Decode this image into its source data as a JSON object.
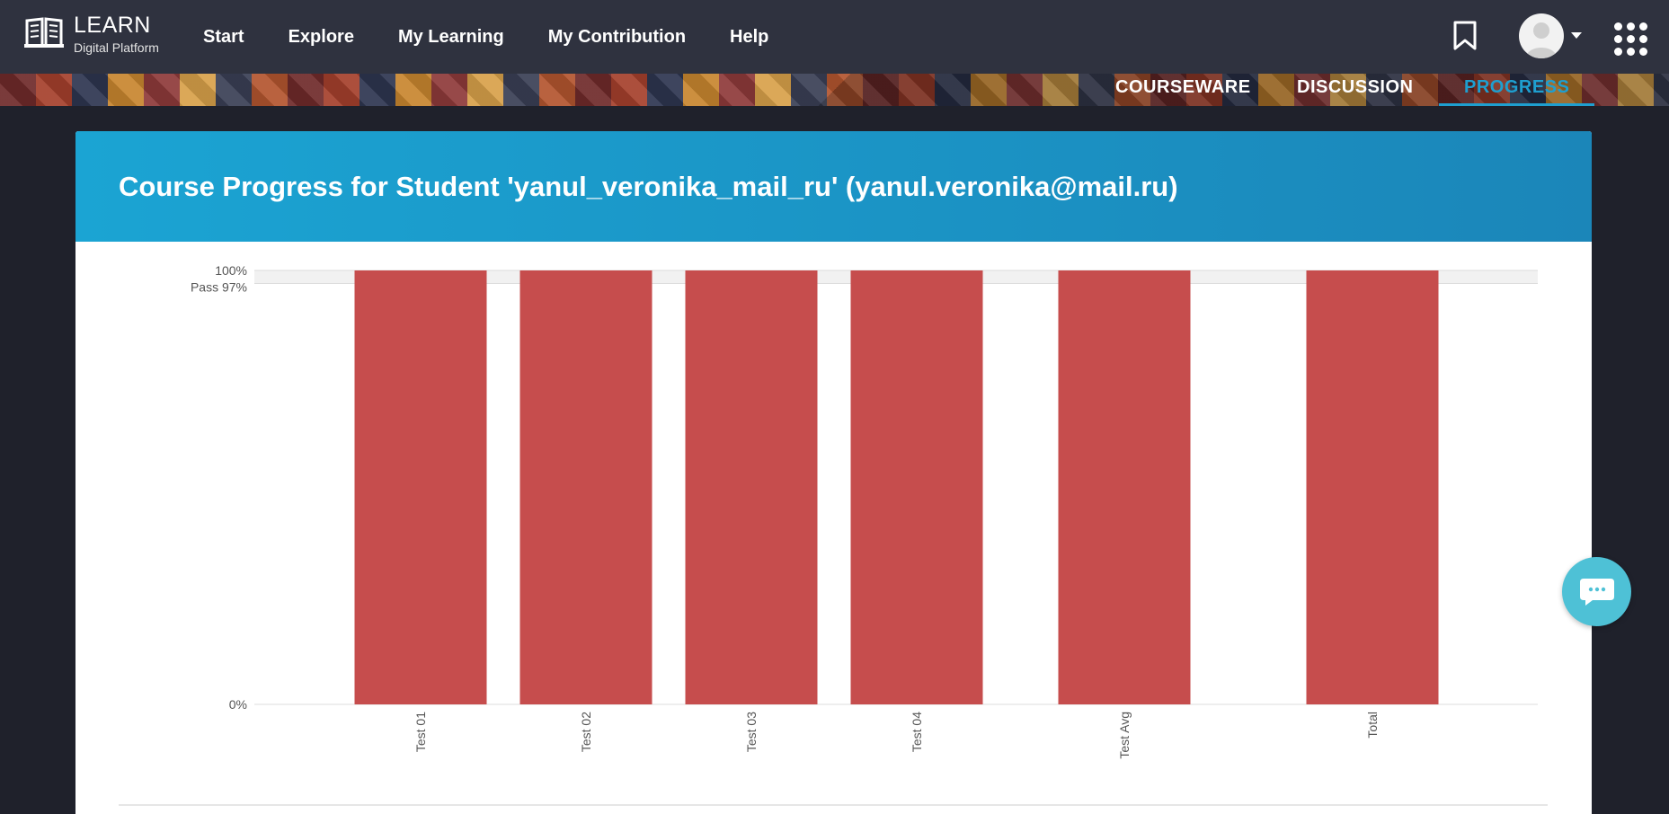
{
  "header": {
    "logo_title": "LEARN",
    "logo_subtitle": "Digital Platform",
    "nav": [
      "Start",
      "Explore",
      "My Learning",
      "My Contribution",
      "Help"
    ]
  },
  "course_tabs": {
    "courseware": "COURSEWARE",
    "discussion": "DISCUSSION",
    "progress": "PROGRESS",
    "active": "PROGRESS"
  },
  "card": {
    "title": "Course Progress for Student 'yanul_veronika_mail_ru' (yanul.veronika@mail.ru)"
  },
  "colors": {
    "bar": "#c64d4d",
    "accent": "#1e9fd0",
    "header_bg": "#2f323f"
  },
  "chart_data": {
    "type": "bar",
    "categories": [
      "Test 01",
      "Test 02",
      "Test 03",
      "Test 04",
      "Test Avg",
      "Total"
    ],
    "values": [
      100,
      100,
      100,
      100,
      100,
      100
    ],
    "ylim": [
      0,
      100
    ],
    "y_ticks": [
      {
        "value": 100,
        "label": "100%"
      },
      {
        "value": 97,
        "label": "Pass 97%"
      },
      {
        "value": 0,
        "label": "0%"
      }
    ],
    "pass_band": [
      97,
      100
    ],
    "grid": false,
    "title": "",
    "xlabel": "",
    "ylabel": ""
  }
}
